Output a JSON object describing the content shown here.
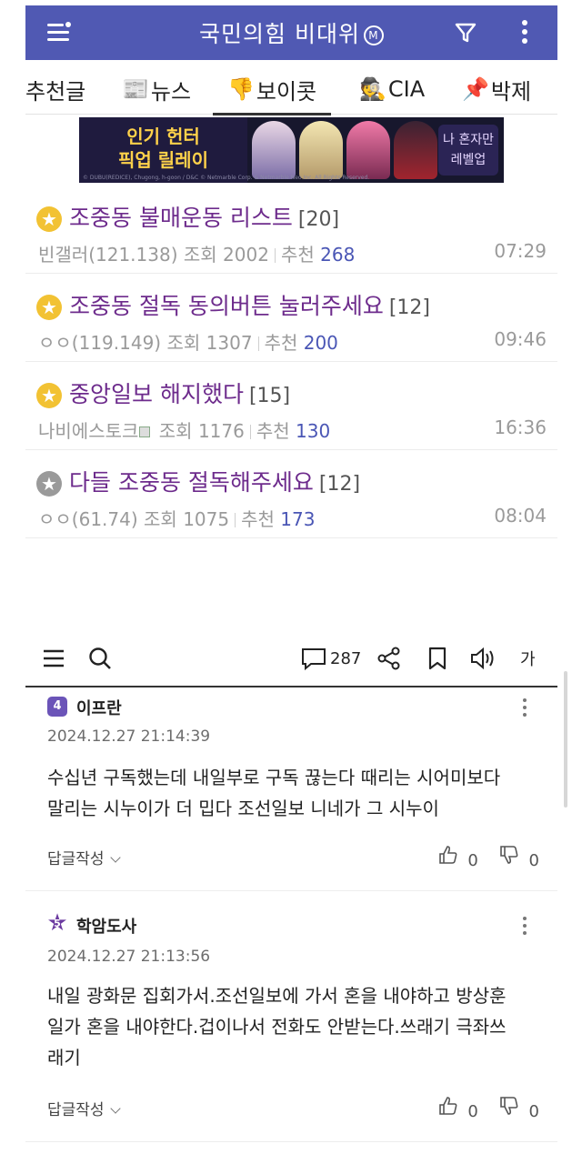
{
  "gallery": {
    "title": "국민의힘 비대위",
    "title_mark": "M",
    "colors": {
      "header_bg": "#5059b3",
      "post_title": "#6d2b8c",
      "rec_count": "#4a56b5",
      "star_gold": "#f2c233"
    },
    "tabs": [
      {
        "label": "추천글",
        "icon": ""
      },
      {
        "label": "뉴스",
        "icon": "📰"
      },
      {
        "label": "보이콧",
        "icon": "👎"
      },
      {
        "label": "CIA",
        "icon": "🕵"
      },
      {
        "label": "박제",
        "icon": "📌"
      }
    ],
    "banner": {
      "headline_1": "인기 헌터",
      "headline_2": "픽업 릴레이",
      "brand_1": "나 혼자만",
      "brand_2": "레벨업",
      "fine_print": "© DUBU(REDICE), Chugong, h-goon / D&C © Netmarble Corp. & Netmarble Neo Inc. All Rights Reserved."
    },
    "posts": [
      {
        "title": "조중동 불매운동 리스트",
        "comments": "[20]",
        "author": "빈갤러(121.138)",
        "views_label": "조회",
        "views": "2002",
        "rec_label": "추천",
        "rec": "268",
        "time": "07:29",
        "star": "gold"
      },
      {
        "title": "조중동 절독 동의버튼 눌러주세요",
        "comments": "[12]",
        "author": "ㅇㅇ(119.149)",
        "views_label": "조회",
        "views": "1307",
        "rec_label": "추천",
        "rec": "200",
        "time": "09:46",
        "star": "gold"
      },
      {
        "title": "중앙일보 해지했다",
        "comments": "[15]",
        "author": "나비에스토크",
        "views_label": "조회",
        "views": "1176",
        "rec_label": "추천",
        "rec": "130",
        "time": "16:36",
        "star": "gold"
      },
      {
        "title": "다들 조중동 절독해주세요",
        "comments": "[12]",
        "author": "ㅇㅇ(61.74)",
        "views_label": "조회",
        "views": "1075",
        "rec_label": "추천",
        "rec": "173",
        "time": "08:04",
        "star": "grey"
      }
    ]
  },
  "news": {
    "comment_count": "287",
    "font_button": "가",
    "comments": [
      {
        "level": "4",
        "name": "이프란",
        "date": "2024.12.27 21:14:39",
        "text_1": "수십년 구독했는데 내일부로 구독 끊는다 때리는 시어미보다",
        "text_2": "말리는 시누이가 더 밉다 조선일보 니네가 그 시누이",
        "reply": "답글작성",
        "likes": "0",
        "dislikes": "0"
      },
      {
        "level": "5",
        "name": "학암도사",
        "date": "2024.12.27 21:13:56",
        "text_1": "내일 광화문 집회가서.조선일보에 가서 혼을 내야하고 방상훈",
        "text_2": "일가 혼을 내야한다.겁이나서 전화도 안받는다.쓰래기 극좌쓰",
        "text_3": "래기",
        "reply": "답글작성",
        "likes": "0",
        "dislikes": "0"
      }
    ]
  }
}
